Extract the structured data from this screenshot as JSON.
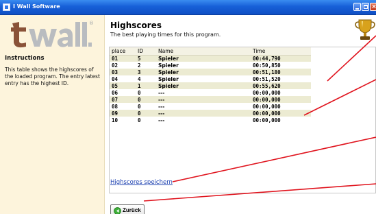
{
  "window": {
    "title": "I Wall Software"
  },
  "sidebar": {
    "logo_registered": "®",
    "instructions_title": "Instructions",
    "instructions_text": "This table shows the highscores of the loaded program. The entry latest entry has the highest ID."
  },
  "main": {
    "title": "Highscores",
    "subtitle": "The best playing times for this program.",
    "columns": [
      "place",
      "ID",
      "Name",
      "Time"
    ],
    "rows": [
      {
        "place": "01",
        "id": "5",
        "name": "Spieler",
        "time": "00:44,790"
      },
      {
        "place": "02",
        "id": "2",
        "name": "Spieler",
        "time": "00:50,850"
      },
      {
        "place": "03",
        "id": "3",
        "name": "Spieler",
        "time": "00:51,180"
      },
      {
        "place": "04",
        "id": "4",
        "name": "Spieler",
        "time": "00:51,520"
      },
      {
        "place": "05",
        "id": "1",
        "name": "Spieler",
        "time": "00:55,620"
      },
      {
        "place": "06",
        "id": "0",
        "name": "---",
        "time": "00:00,000"
      },
      {
        "place": "07",
        "id": "0",
        "name": "---",
        "time": "00:00,000"
      },
      {
        "place": "08",
        "id": "0",
        "name": "---",
        "time": "00:00,000"
      },
      {
        "place": "09",
        "id": "0",
        "name": "---",
        "time": "00:00,000"
      },
      {
        "place": "10",
        "id": "0",
        "name": "---",
        "time": "00:00,000"
      }
    ],
    "save_link": "Highscores speichern",
    "back_label": "Zurück"
  },
  "icons": {
    "app": "app-icon",
    "trophy": "trophy-icon",
    "back": "back-arrow-icon"
  },
  "colors": {
    "titlebar": "#1760d8",
    "sidebar_bg": "#fdf4dc",
    "row_alt": "#ecebd2",
    "link": "#1a3fb0",
    "annotation": "#e0141e"
  }
}
